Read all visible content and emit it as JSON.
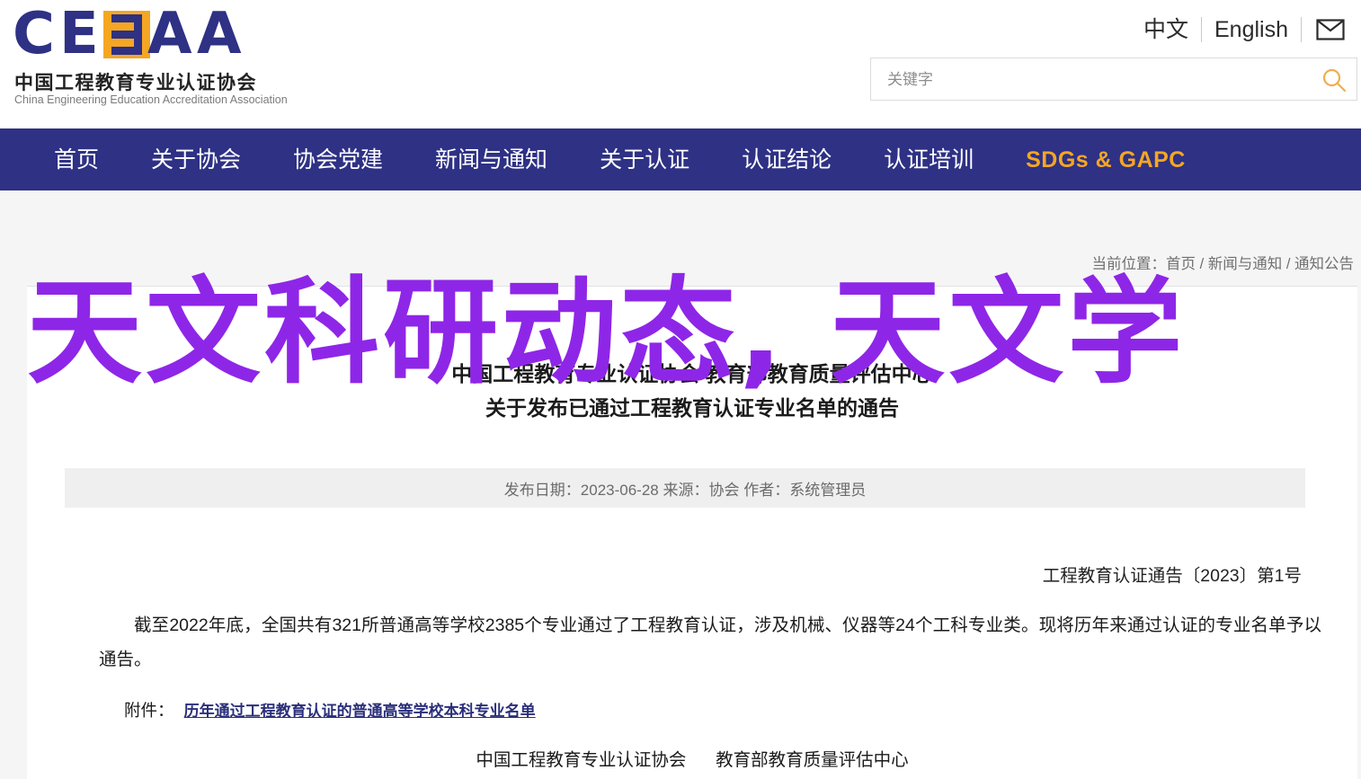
{
  "header": {
    "logo": {
      "letters": [
        "C",
        "E",
        "E",
        "A",
        "A"
      ],
      "cn_name": "中国工程教育专业认证协会",
      "en_name": "China Engineering Education Accreditation Association",
      "brand_color": "#2E3184",
      "accent_color": "#F5A623"
    },
    "lang": {
      "chinese": "中文",
      "english": "English",
      "mail_icon": "envelope-icon"
    },
    "search": {
      "placeholder": "关键字",
      "value": "",
      "icon": "search-icon"
    }
  },
  "nav": {
    "items": [
      {
        "label": "首页",
        "accent": false
      },
      {
        "label": "关于协会",
        "accent": false
      },
      {
        "label": "协会党建",
        "accent": false
      },
      {
        "label": "新闻与通知",
        "accent": false
      },
      {
        "label": "关于认证",
        "accent": false
      },
      {
        "label": "认证结论",
        "accent": false
      },
      {
        "label": "认证培训",
        "accent": false
      },
      {
        "label": "SDGs & GAPC",
        "accent": true
      }
    ],
    "background_color": "#2E3184"
  },
  "breadcrumb": {
    "text": "当前位置：首页 / 新闻与通知 / 通知公告"
  },
  "article": {
    "title_line1": "中国工程教育专业认证协会 教育部教育质量评估中心",
    "title_line2": "关于发布已通过工程教育认证专业名单的通告",
    "meta": "发布日期：2023-06-28   来源：协会   作者：系统管理员",
    "publish_date": "2023-06-28",
    "source": "协会",
    "author": "系统管理员",
    "doc_number": "工程教育认证通告〔2023〕第1号",
    "body": "截至2022年底，全国共有321所普通高等学校2385个专业通过了工程教育认证，涉及机械、仪器等24个工科专业类。现将历年来通过认证的专业名单予以通告。",
    "attachment_label": "附件：",
    "attachment_link": "历年通过工程教育认证的普通高等学校本科专业名单",
    "signature_left": "中国工程教育专业认证协会",
    "signature_right": "教育部教育质量评估中心"
  },
  "overlay": {
    "text": "天文科研动态, 天文学",
    "color": "#8E26E8"
  }
}
